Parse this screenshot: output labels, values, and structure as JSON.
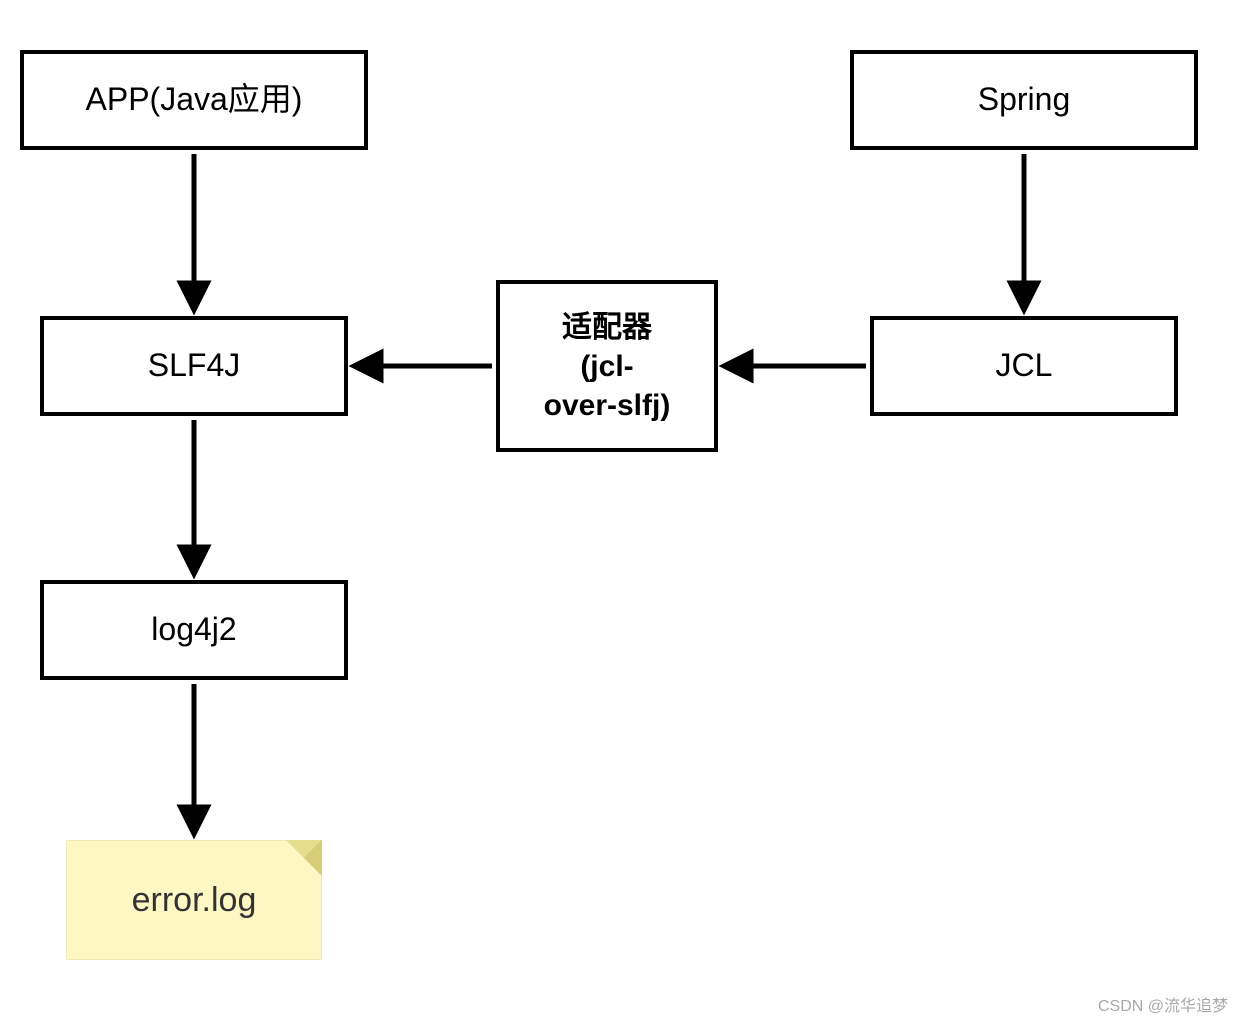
{
  "nodes": {
    "app": {
      "label": "APP(Java应用)"
    },
    "spring": {
      "label": "Spring"
    },
    "slf4j": {
      "label": "SLF4J"
    },
    "adapter": {
      "label": "适配器\n(jcl-\nover-slfj)"
    },
    "jcl": {
      "label": "JCL"
    },
    "log4j2": {
      "label": "log4j2"
    },
    "errorlog": {
      "label": "error.log"
    }
  },
  "edges": [
    {
      "from": "app",
      "to": "slf4j"
    },
    {
      "from": "spring",
      "to": "jcl"
    },
    {
      "from": "jcl",
      "to": "adapter"
    },
    {
      "from": "adapter",
      "to": "slf4j"
    },
    {
      "from": "slf4j",
      "to": "log4j2"
    },
    {
      "from": "log4j2",
      "to": "errorlog"
    }
  ],
  "watermark": "CSDN @流华追梦"
}
